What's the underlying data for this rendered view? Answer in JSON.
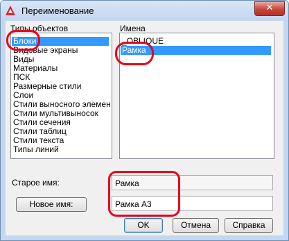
{
  "window": {
    "title": "Переименование",
    "close_glyph": "✕"
  },
  "object_types": {
    "label": "Типы объектов",
    "items": [
      "Блоки",
      "Видовые экраны",
      "Виды",
      "Материалы",
      "ПСК",
      "Размерные стили",
      "Слои",
      "Стили выносного элемен",
      "Стили мультивыносок",
      "Стили сечения",
      "Стили таблиц",
      "Стили текста",
      "Типы линий"
    ],
    "selected": "Блоки"
  },
  "names": {
    "label": "Имена",
    "items": [
      "_OBLIQUE",
      "Рамка"
    ],
    "selected": "Рамка"
  },
  "old_name": {
    "label": "Старое имя:",
    "value": "Рамка"
  },
  "new_name": {
    "button_label": "Новое имя:",
    "value": "Рамка А3"
  },
  "buttons": {
    "ok": "OK",
    "cancel": "Отмена",
    "help": "Справка"
  },
  "colors": {
    "selection": "#3399ff",
    "highlight": "#e8001c",
    "app_icon": "#d8272d"
  },
  "icons": [
    "autocad-app-icon",
    "close-icon"
  ]
}
